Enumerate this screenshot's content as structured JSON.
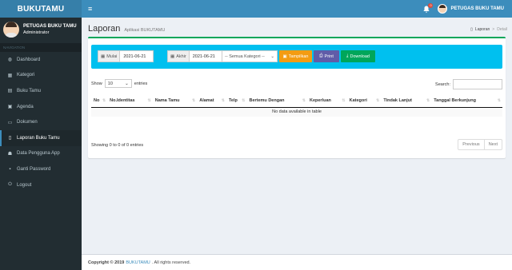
{
  "header": {
    "brand": "BUKUTAMU",
    "menu_icon": "≡",
    "notification_count": "0",
    "user_label": "PETUGAS BUKU TAMU"
  },
  "sidebar": {
    "user_name": "PETUGAS BUKU TAMU",
    "user_role": "Administrator",
    "nav_header": "NAVIGATION",
    "items": [
      {
        "label": "Dashboard",
        "icon": "dashboard-icon",
        "glyph": "◍"
      },
      {
        "label": "Kategori",
        "icon": "grid-icon",
        "glyph": "▦"
      },
      {
        "label": "Buku Tamu",
        "icon": "book-icon",
        "glyph": "▤"
      },
      {
        "label": "Agenda",
        "icon": "calendar-icon",
        "glyph": "▣"
      },
      {
        "label": "Dokumen",
        "icon": "document-icon",
        "glyph": "▭"
      },
      {
        "label": "Laporan Buku Tamu",
        "icon": "file-icon",
        "glyph": "▯"
      },
      {
        "label": "Data Pengguna App",
        "icon": "users-icon",
        "glyph": "☗"
      },
      {
        "label": "Ganti Password",
        "icon": "lock-icon",
        "glyph": "▪"
      },
      {
        "label": "Logout",
        "icon": "power-icon",
        "glyph": "⏻"
      }
    ],
    "active_index": 5
  },
  "page": {
    "title": "Laporan",
    "subtitle": "Aplikasi BUKUTAMU",
    "breadcrumb": [
      "Laporan",
      "Detail"
    ],
    "breadcrumb_sep": ">"
  },
  "filters": {
    "start_label": "Mulai",
    "start_value": "2021-06-21",
    "end_label": "Akhir",
    "end_value": "2021-06-21",
    "category_value": "-- Semua Kategori --",
    "show_button": "Tampilkan",
    "print_button": "Print",
    "download_button": "Download"
  },
  "table": {
    "show_label": "Show",
    "entries_value": "10",
    "entries_label": "entries",
    "search_label": "Search:",
    "columns": [
      "No",
      "No.Identitas",
      "Nama Tamu",
      "Alamat",
      "Telp",
      "Bertemu Dengan",
      "Keperluan",
      "Kategori",
      "Tindak Lanjut",
      "Tanggal Berkunjung"
    ],
    "empty_text": "No data available in table",
    "info_text": "Showing 0 to 0 of 0 entries",
    "prev_label": "Previous",
    "next_label": "Next"
  },
  "footer": {
    "copyright": "Copyright © 2019",
    "brand_link": "BUKUTAMU",
    "rights": ". All rights reserved."
  },
  "colors": {
    "header": "#3c8dbc",
    "brand_bg": "#367fa9",
    "sidebar": "#222d32",
    "filter_bar": "#00c0ef",
    "box_border": "#00a65a",
    "btn_show": "#f39c12",
    "btn_print": "#605ca8",
    "btn_download": "#00a65a"
  }
}
